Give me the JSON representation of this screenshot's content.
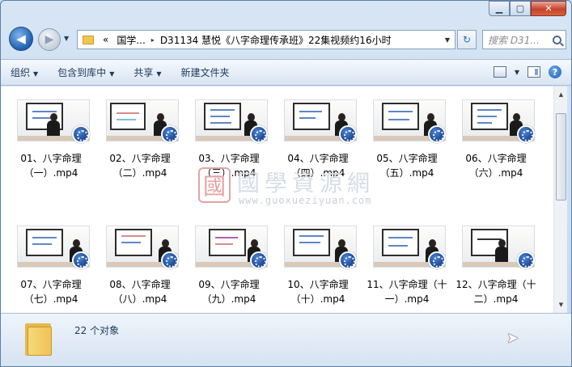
{
  "window": {
    "caption_min": "▁",
    "caption_max": "▢",
    "caption_close": "✕"
  },
  "nav": {
    "back": "◀",
    "forward": "▶",
    "dropdown": "▼"
  },
  "address": {
    "overflow": "«",
    "seg1": "国学...",
    "sep1": "▸",
    "seg2": "D31134 慧悦《八字命理传承班》22集视频约16小时",
    "arrow": "▼"
  },
  "refresh": "↻",
  "search": {
    "placeholder": "搜索 D31..."
  },
  "toolbar": {
    "organize": "组织",
    "include_in_library": "包含到库中",
    "share": "共享",
    "new_folder": "新建文件夹",
    "caret": "▼",
    "help": "?"
  },
  "files": [
    {
      "label": "01、八字命理（一）.mp4"
    },
    {
      "label": "02、八字命理（二）.mp4"
    },
    {
      "label": "03、八字命理（三）.mp4"
    },
    {
      "label": "04、八字命理（四）.mp4"
    },
    {
      "label": "05、八字命理（五）.mp4"
    },
    {
      "label": "06、八字命理（六）.mp4"
    },
    {
      "label": "07、八字命理（七）.mp4"
    },
    {
      "label": "08、八字命理（八）.mp4"
    },
    {
      "label": "09、八字命理（九）.mp4"
    },
    {
      "label": "10、八字命理（十）.mp4"
    },
    {
      "label": "11、八字命理（十一）.mp4"
    },
    {
      "label": "12、八字命理（十二）.mp4"
    }
  ],
  "watermark": {
    "seal": "國",
    "title": "國學資源網",
    "url": "www.guoxueziyuan.com"
  },
  "status": {
    "count": "22 个对象"
  },
  "scrollbar": {
    "up": "▲",
    "down": "▼"
  }
}
